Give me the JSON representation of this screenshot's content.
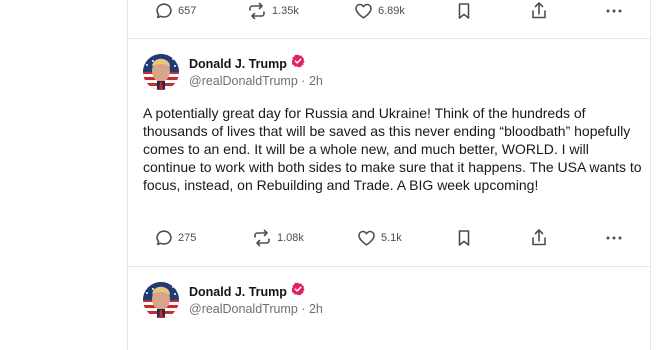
{
  "top_post": {
    "replies": "657",
    "reposts": "1.35k",
    "likes": "6.89k"
  },
  "main_post": {
    "author_name": "Donald J. Trump",
    "handle": "@realDonaldTrump",
    "separator": "·",
    "time": "2h",
    "text": "A potentially great day for Russia and Ukraine! Think of the hundreds of thousands of lives that will be saved as this never ending “bloodbath” hopefully comes to an end. It will be a whole new, and much better, WORLD. I will continue to work with both sides to make sure that it happens. The USA wants to focus, instead, on Rebuilding and Trade. A BIG week upcoming!",
    "replies": "275",
    "reposts": "1.08k",
    "likes": "5.1k"
  },
  "next_post": {
    "author_name": "Donald J. Trump",
    "handle": "@realDonaldTrump",
    "separator": "·",
    "time": "2h"
  },
  "colors": {
    "verified_badge": "#e0245e",
    "action_icon": "#4a4f55",
    "divider": "#e6e6e6"
  },
  "icons": [
    "reply-icon",
    "repost-icon",
    "like-icon",
    "bookmark-icon",
    "share-icon",
    "more-icon",
    "verified-icon"
  ]
}
